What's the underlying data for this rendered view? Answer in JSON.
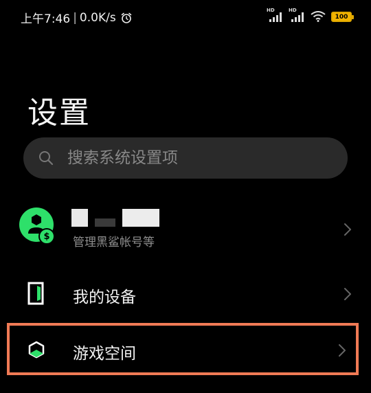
{
  "status_bar": {
    "time": "上午7:46",
    "separator": "|",
    "net_speed": "0.0K/s",
    "signal1_label": "HD",
    "signal2_label": "HD",
    "battery": "100",
    "battery_color": "#f4b400"
  },
  "page": {
    "title": "设置"
  },
  "search": {
    "placeholder": "搜索系统设置项",
    "value": ""
  },
  "account": {
    "subtitle": "管理黑鲨帐号等",
    "coin_symbol": "$",
    "avatar_color": "#2ee06a"
  },
  "items": [
    {
      "label": "我的设备",
      "icon": "phone-frame-icon"
    },
    {
      "label": "游戏空间",
      "icon": "cube-icon"
    }
  ],
  "highlight_color": "#f07a55"
}
